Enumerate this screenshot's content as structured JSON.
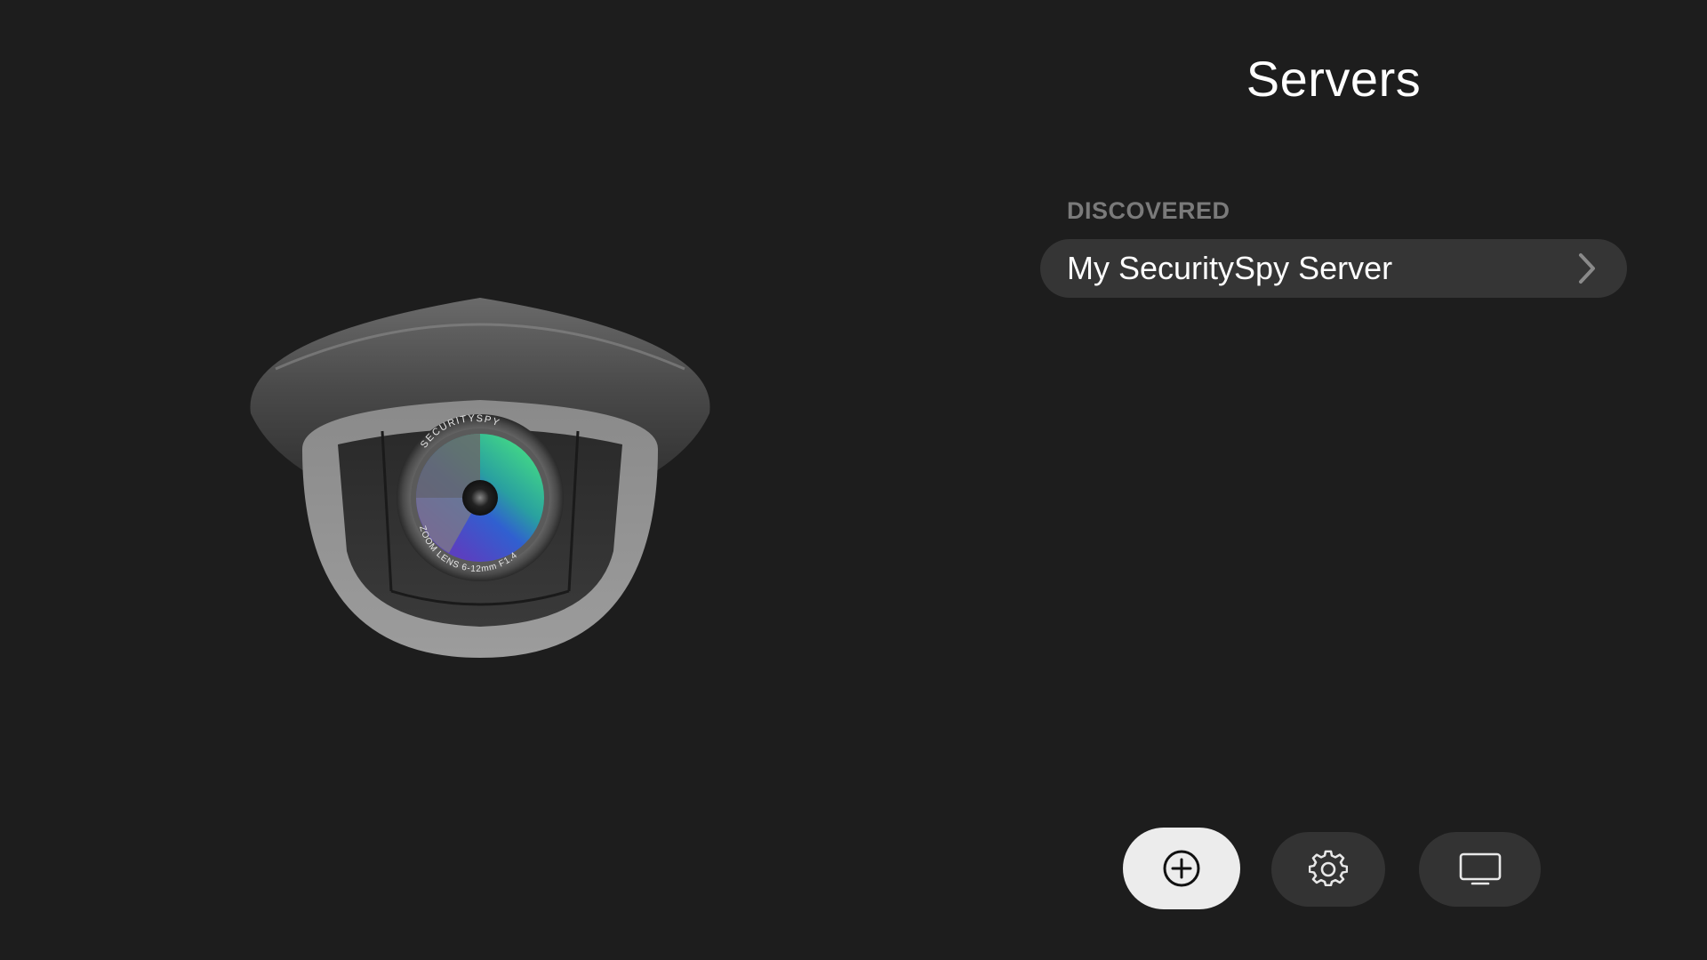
{
  "header": {
    "title": "Servers"
  },
  "discovered": {
    "section_label": "DISCOVERED",
    "servers": [
      {
        "name": "My SecuritySpy Server"
      }
    ]
  },
  "camera_art": {
    "lens_top_text": "SECURITYSPY",
    "lens_bottom_text": "ZOOM LENS 6-12mm F1.4"
  },
  "toolbar": {
    "buttons": [
      {
        "icon": "add-circle-icon",
        "state": "focused"
      },
      {
        "icon": "gear-icon"
      },
      {
        "icon": "display-icon"
      }
    ]
  },
  "colors": {
    "background": "#1d1d1d",
    "row_background": "#353535",
    "button_background": "#333333",
    "focused_button": "#ececec",
    "section_label": "#7a7a7a"
  }
}
